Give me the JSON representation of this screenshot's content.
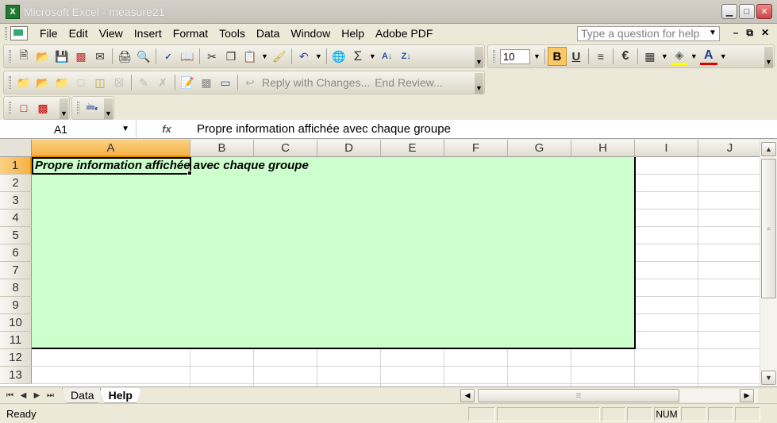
{
  "window": {
    "title": "Microsoft Excel - measure21",
    "icon": "excel-app-icon",
    "app_letter": "X"
  },
  "menu": {
    "items": [
      "File",
      "Edit",
      "View",
      "Insert",
      "Format",
      "Tools",
      "Data",
      "Window",
      "Help",
      "Adobe PDF"
    ],
    "help_placeholder": "Type a question for help"
  },
  "toolbar": {
    "font_size": "10",
    "bold_label": "B",
    "underline_label": "U",
    "euro_label": "€",
    "sum_label": "Σ",
    "reply_label": "Reply with Changes...",
    "end_review_label": "End Review..."
  },
  "formula": {
    "cell_ref": "A1",
    "fx_label": "fx",
    "content": "Propre information affichée avec chaque groupe"
  },
  "grid": {
    "columns": [
      "A",
      "B",
      "C",
      "D",
      "E",
      "F",
      "G",
      "H",
      "I",
      "J"
    ],
    "rows": [
      "1",
      "2",
      "3",
      "4",
      "5",
      "6",
      "7",
      "8",
      "9",
      "10",
      "11",
      "12",
      "13"
    ],
    "cell_a1": "Propre information affichée avec chaque groupe",
    "selected_cell": "A1",
    "highlight_color": "#ccffcc"
  },
  "sheets": {
    "tabs": [
      "Data",
      "Help"
    ],
    "active": "Help"
  },
  "status": {
    "text": "Ready",
    "num": "NUM"
  }
}
